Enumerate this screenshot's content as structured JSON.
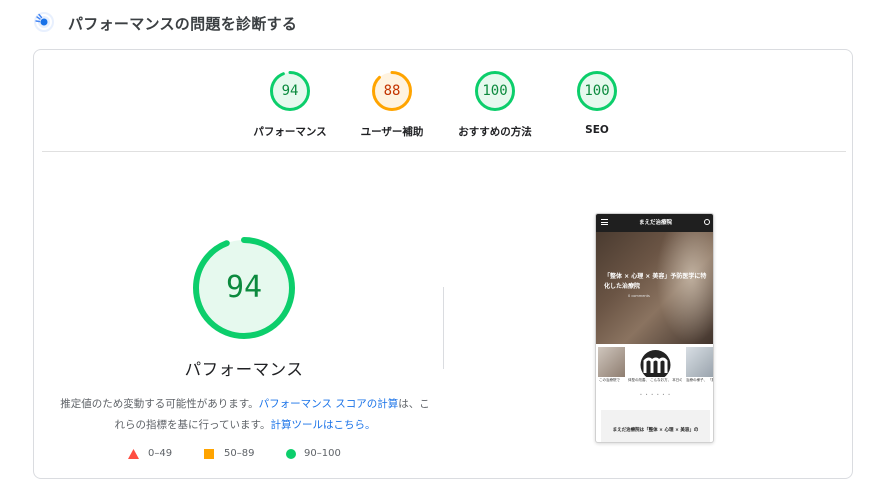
{
  "header": {
    "title": "パフォーマンスの問題を診断する",
    "icon": "lighthouse-gauge-icon"
  },
  "colors": {
    "pass": "#0cce6b",
    "pass_text": "#0c8a3e",
    "average": "#ffa400",
    "average_text": "#c33300",
    "fail": "#ff4e42"
  },
  "gauges": [
    {
      "label": "パフォーマンス",
      "score": "94",
      "value": 0.94,
      "status": "pass"
    },
    {
      "label": "ユーザー補助",
      "score": "88",
      "value": 0.88,
      "status": "average"
    },
    {
      "label": "おすすめの方法",
      "score": "100",
      "value": 1.0,
      "status": "pass"
    },
    {
      "label": "SEO",
      "score": "100",
      "value": 1.0,
      "status": "pass"
    }
  ],
  "main": {
    "score": "94",
    "value": 0.94,
    "title": "パフォーマンス",
    "desc_prefix": "推定値のため変動する可能性があります。",
    "desc_link1": "パフォーマンス スコアの計算",
    "desc_middle": "は、これらの指標を基に行っています。",
    "desc_link2": "計算ツールはこちら。"
  },
  "legend": [
    {
      "shape": "triangle-icon",
      "range": "0–49"
    },
    {
      "shape": "square-icon",
      "range": "50–89"
    },
    {
      "shape": "circle-icon",
      "range": "90–100"
    }
  ],
  "screenshot": {
    "site_title": "まえだ治療院",
    "hero_text": "「整体 × 心理 × 美容」予防医学に特化した治療院",
    "hero_meta": "0 comments",
    "captions": [
      "この治療院で",
      "体型の改善、 こんなお方、 本日の治療",
      "治療の様子、 「腰が痛い」"
    ],
    "dots": "• • • • • •",
    "bottom_text": "まえだ治療院は「整体 × 心理 × 美容」の"
  }
}
